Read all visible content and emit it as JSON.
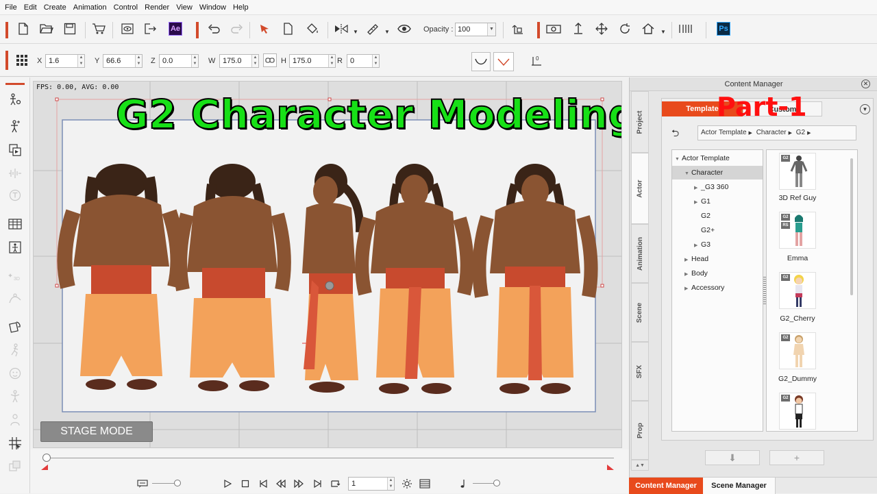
{
  "menu": [
    "File",
    "Edit",
    "Create",
    "Animation",
    "Control",
    "Render",
    "View",
    "Window",
    "Help"
  ],
  "toolbar": {
    "opacity_label": "Opacity :",
    "opacity_value": "100",
    "ae_label": "Ae",
    "ps_label": "Ps"
  },
  "transform": {
    "x_label": "X",
    "x_value": "1.6",
    "y_label": "Y",
    "y_value": "66.6",
    "z_label": "Z",
    "z_value": "0.0",
    "w_label": "W",
    "w_value": "175.0",
    "h_label": "H",
    "h_value": "175.0",
    "r_label": "R",
    "r_value": "0"
  },
  "viewport": {
    "fps_text": "FPS: 0.00, AVG: 0.00",
    "title_overlay": "G2 Character Modeling",
    "stage_mode_label": "STAGE MODE"
  },
  "timeline": {
    "frame_value": "1"
  },
  "content_manager": {
    "title": "Content Manager",
    "vertical_tabs": [
      "Project",
      "Actor",
      "Animation",
      "Scene",
      "SFX",
      "Prop"
    ],
    "active_vertical_tab": "Actor",
    "tab_template": "Template",
    "tab_custom": "Custom",
    "overlay_label": "Part-1",
    "breadcrumb": [
      "Actor Template",
      "Character",
      "G2"
    ],
    "tree": [
      {
        "label": "Actor Template",
        "depth": 0,
        "arrow": "▼"
      },
      {
        "label": "Character",
        "depth": 1,
        "arrow": "▼",
        "selected": true
      },
      {
        "label": "_G3 360",
        "depth": 2,
        "arrow": "▶"
      },
      {
        "label": "G1",
        "depth": 2,
        "arrow": "▶"
      },
      {
        "label": "G2",
        "depth": 2,
        "arrow": ""
      },
      {
        "label": "G2+",
        "depth": 2,
        "arrow": ""
      },
      {
        "label": "G3",
        "depth": 2,
        "arrow": "▶"
      },
      {
        "label": "Head",
        "depth": 1,
        "arrow": "▶"
      },
      {
        "label": "Body",
        "depth": 1,
        "arrow": "▶"
      },
      {
        "label": "Accessory",
        "depth": 1,
        "arrow": "▶"
      }
    ],
    "items": [
      {
        "label": "3D Ref Guy",
        "badges": [
          "G2"
        ]
      },
      {
        "label": "Emma",
        "badges": [
          "G2",
          "RS"
        ]
      },
      {
        "label": "G2_Cherry",
        "badges": [
          "G2"
        ]
      },
      {
        "label": "G2_Dummy",
        "badges": [
          "G2"
        ]
      },
      {
        "label": "",
        "badges": [
          "G2"
        ]
      }
    ]
  },
  "bottom_tabs": {
    "content_manager": "Content Manager",
    "scene_manager": "Scene Manager"
  },
  "colors": {
    "accent": "#e84a1c",
    "title_green": "#17e017",
    "part_red": "#ff1010"
  }
}
